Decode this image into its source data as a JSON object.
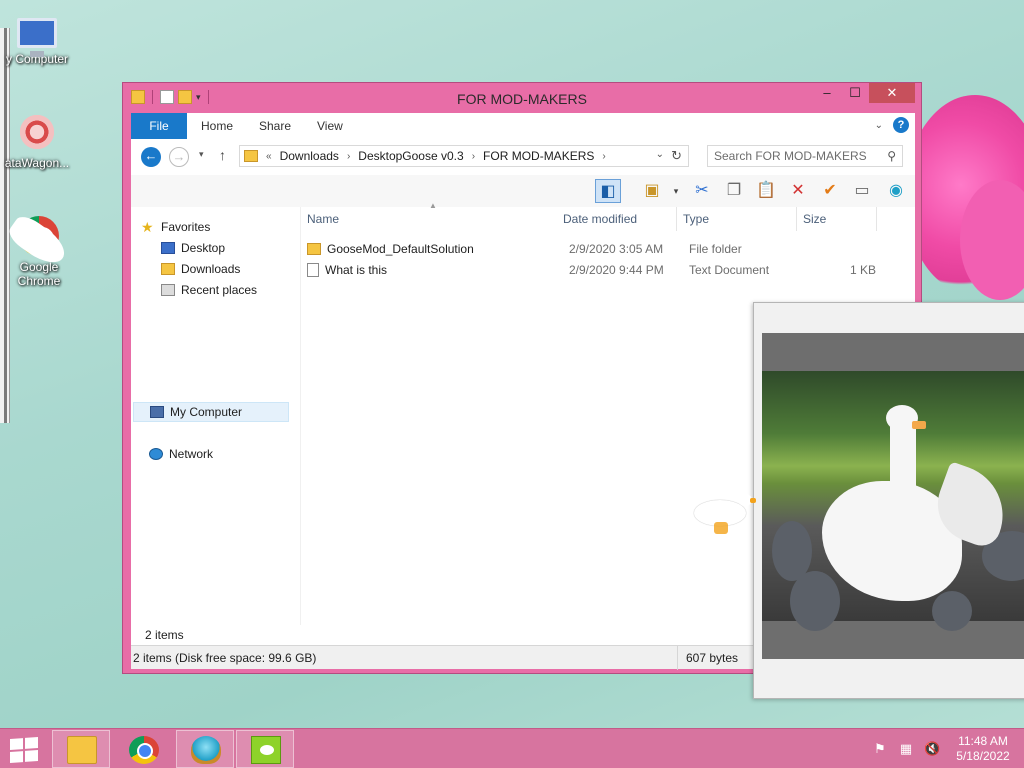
{
  "desktop": {
    "icons": [
      {
        "label": "y Computer",
        "icon": "computer-icon"
      },
      {
        "label": "ataWagon...",
        "icon": "datawagon-icon"
      },
      {
        "label": "Google Chrome",
        "icon": "chrome-icon"
      }
    ]
  },
  "window": {
    "title": "FOR MOD-MAKERS",
    "caption": {
      "minimize": "–",
      "maximize": "☐",
      "close": "✕"
    }
  },
  "ribbon": {
    "tabs": [
      "File",
      "Home",
      "Share",
      "View"
    ],
    "help": "?"
  },
  "address": {
    "overflow": "«",
    "crumbs": [
      "Downloads",
      "DesktopGoose v0.3",
      "FOR MOD-MAKERS"
    ]
  },
  "search": {
    "placeholder": "Search FOR MOD-MAKERS"
  },
  "toolbar": {
    "icons": [
      "preview-pane-icon",
      "properties-icon",
      "cut-icon",
      "copy-icon",
      "paste-icon",
      "delete-icon",
      "check-icon",
      "rename-icon",
      "globe-icon"
    ]
  },
  "nav_pane": {
    "favorites": "Favorites",
    "desktop": "Desktop",
    "downloads": "Downloads",
    "recent": "Recent places",
    "my_computer": "My Computer",
    "network": "Network"
  },
  "columns": [
    "Name",
    "Date modified",
    "Type",
    "Size"
  ],
  "files": [
    {
      "name": "GooseMod_DefaultSolution",
      "date": "2/9/2020 3:05 AM",
      "type": "File folder",
      "size": "",
      "icon": "folder-icon"
    },
    {
      "name": "What is this",
      "date": "2/9/2020 9:44 PM",
      "type": "Text Document",
      "size": "1 KB",
      "icon": "text-file-icon"
    }
  ],
  "status": {
    "count": "2 items",
    "detail": "2 items (Disk free space: 99.6 GB)",
    "size": "607 bytes"
  },
  "taskbar": {
    "buttons": [
      "file-explorer",
      "google-chrome",
      "shell-app",
      "desktop-goose"
    ],
    "time": "11:48 AM",
    "date": "5/18/2022"
  },
  "colors": {
    "window_frame": "#e86da7",
    "accent_blue": "#1979ca",
    "taskbar": "#d7749f"
  }
}
